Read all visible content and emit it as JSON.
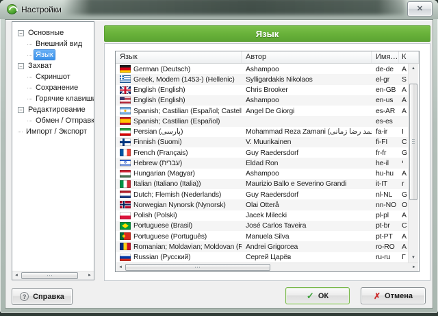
{
  "window": {
    "title": "Настройки",
    "close_glyph": "✕"
  },
  "ui": {
    "arrow_up": "▲",
    "arrow_down": "▼",
    "arrow_left": "◄",
    "arrow_right": "►",
    "collapse_glyph": "−"
  },
  "sidebar": {
    "items": [
      {
        "label": "Основные",
        "level": 0,
        "expandable": true,
        "selected": false
      },
      {
        "label": "Внешний вид",
        "level": 1,
        "expandable": false,
        "selected": false
      },
      {
        "label": "Язык",
        "level": 1,
        "expandable": false,
        "selected": true
      },
      {
        "label": "Захват",
        "level": 0,
        "expandable": true,
        "selected": false
      },
      {
        "label": "Скриншот",
        "level": 1,
        "expandable": false,
        "selected": false
      },
      {
        "label": "Сохранение",
        "level": 1,
        "expandable": false,
        "selected": false
      },
      {
        "label": "Горячие клавиши",
        "level": 1,
        "expandable": false,
        "selected": false
      },
      {
        "label": "Редактирование",
        "level": 0,
        "expandable": true,
        "selected": false
      },
      {
        "label": "Обмен / Отправка",
        "level": 1,
        "expandable": false,
        "selected": false
      },
      {
        "label": "Импорт / Экспорт",
        "level": 0,
        "expandable": false,
        "selected": false
      }
    ]
  },
  "main": {
    "header": "Язык",
    "table": {
      "columns": [
        "Язык",
        "Автор",
        "Имя…",
        "К"
      ],
      "rows": [
        {
          "flag": "de",
          "language": "German (Deutsch)",
          "author": "Ashampoo",
          "code": "de-de",
          "extra": "A"
        },
        {
          "flag": "gr",
          "language": "Greek, Modern (1453-) (Hellenic)",
          "author": "Sylligardakis Nikolaos",
          "code": "el-gr",
          "extra": "S"
        },
        {
          "flag": "gb",
          "language": "English (English)",
          "author": "Chris Brooker",
          "code": "en-GB",
          "extra": "A"
        },
        {
          "flag": "us",
          "language": "English (English)",
          "author": "Ashampoo",
          "code": "en-us",
          "extra": "A"
        },
        {
          "flag": "ar",
          "language": "Spanish; Castilian (Español; Castellano)",
          "author": "Angel De Giorgi",
          "code": "es-AR",
          "extra": "A"
        },
        {
          "flag": "es",
          "language": "Spanish; Castilian (Español)",
          "author": "",
          "code": "es-es",
          "extra": ""
        },
        {
          "flag": "ir",
          "language": "Persian (پارسی)",
          "author": "Mohammad Reza Zamani (محمد رضا زمانی)",
          "code": "fa-ir",
          "extra": "I"
        },
        {
          "flag": "fi",
          "language": "Finnish (Suomi)",
          "author": "V. Muurikainen",
          "code": "fi-FI",
          "extra": "C"
        },
        {
          "flag": "fr",
          "language": "French (Français)",
          "author": "Guy Raedersdorf",
          "code": "fr-fr",
          "extra": "G"
        },
        {
          "flag": "il",
          "language": "Hebrew (עברית)",
          "author": "Eldad Ron",
          "code": "he-il",
          "extra": "י"
        },
        {
          "flag": "hu",
          "language": "Hungarian (Magyar)",
          "author": "Ashampoo",
          "code": "hu-hu",
          "extra": "A"
        },
        {
          "flag": "it",
          "language": "Italian (Italiano (Italia))",
          "author": "Maurizio Ballo e Severino Grandi",
          "code": "it-IT",
          "extra": "r"
        },
        {
          "flag": "nl",
          "language": "Dutch; Flemish (Nederlands)",
          "author": "Guy Raedersdorf",
          "code": "nl-NL",
          "extra": "G"
        },
        {
          "flag": "no",
          "language": "Norwegian Nynorsk (Nynorsk)",
          "author": "Olai Otterå",
          "code": "nn-NO",
          "extra": "O"
        },
        {
          "flag": "pl",
          "language": "Polish (Polski)",
          "author": "Jacek Milecki",
          "code": "pl-pl",
          "extra": "A"
        },
        {
          "flag": "br",
          "language": "Portuguese (Brasil)",
          "author": "José Carlos Taveira",
          "code": "pt-br",
          "extra": "C"
        },
        {
          "flag": "pt",
          "language": "Portuguese (Português)",
          "author": "Manuela Silva",
          "code": "pt-PT",
          "extra": "A"
        },
        {
          "flag": "ro",
          "language": "Romanian; Moldavian; Moldovan (Română)",
          "author": "Andrei Grigorcea",
          "code": "ro-RO",
          "extra": "A"
        },
        {
          "flag": "ru",
          "language": "Russian (Русский)",
          "author": "Сергей Царёв",
          "code": "ru-ru",
          "extra": "Г"
        }
      ]
    }
  },
  "footer": {
    "help_label": "Справка",
    "help_glyph": "?",
    "ok_label": "ОК",
    "ok_glyph": "✓",
    "cancel_label": "Отмена",
    "cancel_glyph": "✗"
  },
  "colors": {
    "header_green": "#69b23a",
    "selection_blue": "#3b92ea",
    "check_green": "#3fa23c",
    "cross_red": "#cc2b2b"
  }
}
